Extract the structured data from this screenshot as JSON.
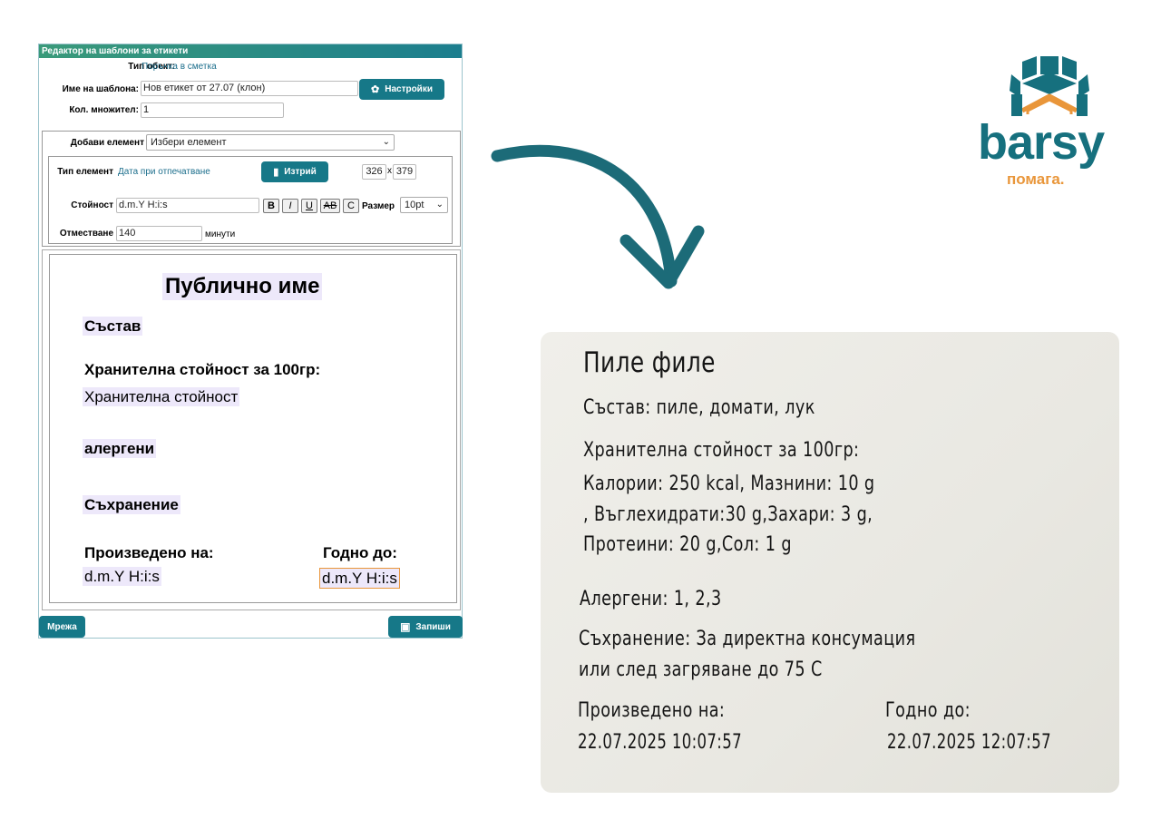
{
  "editor": {
    "title": "Редактор на шаблони за етикети",
    "object_type_label": "Тип обект:",
    "object_type_value": "Поръчка в сметка",
    "template_name_label": "Име на шаблона:",
    "template_name_value": "Нов етикет от 27.07 (клон)",
    "settings_button": "Настройки",
    "qty_multiplier_label": "Кол. множител:",
    "qty_multiplier_value": "1",
    "add_element_label": "Добави елемент",
    "add_element_select": "Избери елемент",
    "element_type_label": "Тип елемент",
    "element_type_value": "Дата при отпечатване",
    "delete_button": "Изтрий",
    "pos_x": "326",
    "pos_sep": "x",
    "pos_y": "379",
    "value_label": "Стойност",
    "value_input": "d.m.Y H:i:s",
    "bold_btn": "B",
    "italic_btn": "I",
    "underline_btn": "U",
    "strike_btn": "AB",
    "case_btn": "C",
    "size_label": "Размер",
    "size_value": "10pt",
    "offset_label": "Отместване",
    "offset_value": "140",
    "offset_unit": "минути",
    "grid_button": "Мрежа",
    "save_button": "Запиши"
  },
  "preview": {
    "public_name": "Публично име",
    "composition": "Състав",
    "nutrition_heading": "Хранителна стойност за 100гр:",
    "nutrition_value": "Хранителна стойност",
    "allergens": "алергени",
    "storage": "Съхранение",
    "produced_label": "Произведено на:",
    "produced_value": "d.m.Y H:i:s",
    "expiry_label": "Годно до:",
    "expiry_value": "d.m.Y H:i:s"
  },
  "logo": {
    "brand": "barsy",
    "tagline": "помага.",
    "brand_color": "#16707e",
    "accent_color": "#e9963a"
  },
  "printed_label": {
    "name": "Пиле филе",
    "composition": "Състав:  пиле, домати, лук",
    "nutrition_heading": "Хранителна стойност за 100гр:",
    "nutrition_line1": "Калории:  250 kcal, Мазнини: 10 g",
    "nutrition_line2": ", Въглехидрати:30 g,Захари: 3 g,",
    "nutrition_line3": "Протеини: 20 g,Сол: 1 g",
    "allergens": "Алергени:  1, 2,3",
    "storage_line1": "Съхранение:  За директна консумация",
    "storage_line2": "или след загряване до 75 С",
    "produced_label": "Произведено на:",
    "produced_value": "22.07.2025 10:07:57",
    "expiry_label": "Годно до:",
    "expiry_value": "22.07.2025 12:07:57"
  },
  "colors": {
    "teal": "#167888",
    "preview_highlight": "#ede8fa"
  }
}
